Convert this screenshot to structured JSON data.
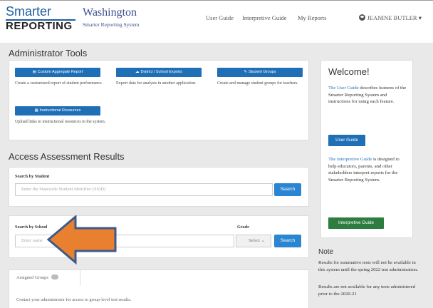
{
  "header": {
    "logo_top": "Smarter",
    "logo_bottom": "REPORTING",
    "state": "Washington",
    "system": "Smarter Reporting System",
    "nav": [
      "User Guide",
      "Interpretive Guide",
      "My Reports"
    ],
    "user": "JEANINE BUTLER ▾"
  },
  "admin": {
    "title": "Administrator Tools",
    "tools": [
      {
        "label": "Custom Aggregate Report",
        "icon": "chart-icon",
        "glyph": "▤",
        "desc": "Create a customized report of student performance."
      },
      {
        "label": "District / School Exports",
        "icon": "cloud-download-icon",
        "glyph": "☁",
        "desc": "Export data for analysis in another application."
      },
      {
        "label": "Student Groups",
        "icon": "edit-icon",
        "glyph": "✎",
        "desc": "Create and manage student groups for teachers."
      },
      {
        "label": "Instructional Resources",
        "icon": "calendar-icon",
        "glyph": "▦",
        "desc": "Upload links to instructional resources in the system."
      }
    ]
  },
  "access": {
    "title": "Access Assessment Results",
    "student": {
      "label": "Search by Student",
      "placeholder": "Enter the Statewide Student Identifier (SSID)",
      "button": "Search"
    },
    "school": {
      "label": "Search by School",
      "placeholder": "Enter name",
      "grade_label": "Grade",
      "grade_select": "Select ⌄",
      "button": "Search"
    },
    "groups": {
      "tab": "Assigned Groups",
      "note": "Contact your administrator for access to group-level test results."
    }
  },
  "welcome": {
    "title": "Welcome!",
    "p1_link": "The User Guide",
    "p1_rest": " describes features of the Smarter Reporting System and instructions for using each feature.",
    "user_guide_btn": "User Guide",
    "p2_link": "The Interpretive Guide",
    "p2_rest": " is designed to help educators, parents, and other stakeholders interpret reports for the Smarter Reporting System.",
    "interp_btn": "Interpretive Guide"
  },
  "note": {
    "title": "Note",
    "p1": "Results for summative tests will not be available in this system until the spring 2022 test administration.",
    "p2": "Results are not available for any tests administered prior to the 2020-21"
  },
  "colors": {
    "primary": "#1f6fb7",
    "search": "#2a86d2",
    "green": "#2c7d3f",
    "arrow_fill": "#e8802f",
    "arrow_stroke": "#3d5a8c"
  }
}
